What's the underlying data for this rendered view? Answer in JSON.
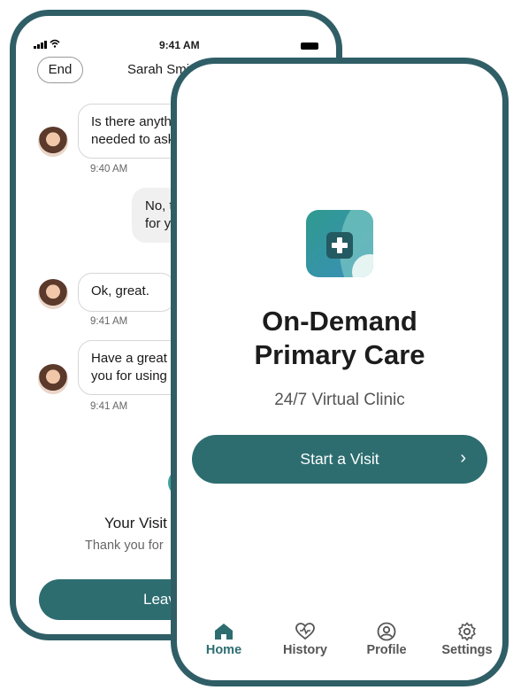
{
  "back_screen": {
    "status_time": "9:41 AM",
    "end_label": "End",
    "contact_name": "Sarah Smi",
    "messages": [
      {
        "text": "Is there anythi\nneeded to ask",
        "time": "9:40 AM"
      },
      {
        "text": "No, tl\nfor yo",
        "time": ""
      },
      {
        "text": "Ok, great.",
        "time": "9:41 AM"
      },
      {
        "text": "Have a great c\nyou for using",
        "time": "9:41 AM"
      }
    ],
    "visit_title": "Your Visit",
    "visit_subtitle": "Thank you for",
    "leave_label": "Leav"
  },
  "front_screen": {
    "title": "On-Demand\nPrimary Care",
    "subtitle": "24/7 Virtual Clinic",
    "start_label": "Start a Visit",
    "start_chevron": "›",
    "tabs": [
      {
        "label": "Home",
        "icon": "home-icon",
        "active": true
      },
      {
        "label": "History",
        "icon": "heart-icon",
        "active": false
      },
      {
        "label": "Profile",
        "icon": "user-circle-icon",
        "active": false
      },
      {
        "label": "Settings",
        "icon": "gear-icon",
        "active": false
      }
    ]
  },
  "colors": {
    "accent": "#2d6d70",
    "frame": "#2f5e66",
    "check_ring": "#3aa39a"
  }
}
